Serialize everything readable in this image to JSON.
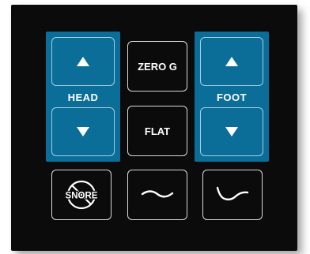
{
  "colors": {
    "panel": "#0b0b0c",
    "accent_blue": "#0b6e99",
    "text": "#ffffff"
  },
  "head": {
    "label": "HEAD",
    "up_icon": "triangle-up-icon",
    "down_icon": "triangle-down-icon"
  },
  "foot": {
    "label": "FOOT",
    "up_icon": "triangle-up-icon",
    "down_icon": "triangle-down-icon"
  },
  "presets": {
    "zero_g_label": "ZERO G",
    "flat_label": "FLAT"
  },
  "bottom_row": {
    "snore_text": "SNORE",
    "snore_icon": "no-snore-icon",
    "wave_flat_icon": "wave-flat-icon",
    "wave_lounge_icon": "wave-lounge-icon"
  }
}
